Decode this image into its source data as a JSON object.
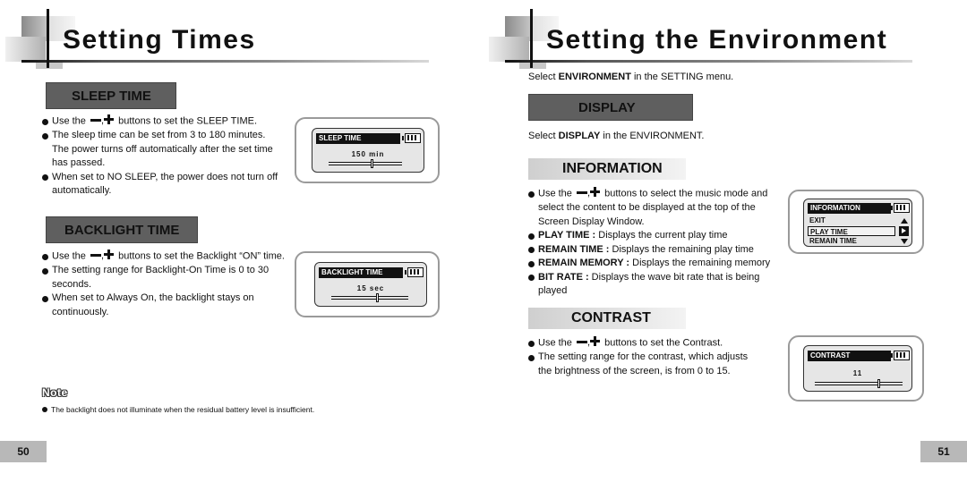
{
  "left_page": {
    "title": "Setting Times",
    "page_number": "50",
    "sleep_time": {
      "heading": "SLEEP TIME",
      "bullets": [
        {
          "pre": "Use the",
          "post": "buttons to set the SLEEP TIME."
        },
        {
          "text": "The sleep time can be set from 3 to 180 minutes. The power turns off automatically after the set time has passed."
        },
        {
          "text": "When set to NO SLEEP, the power does not turn off automatically."
        }
      ],
      "screen": {
        "label": "SLEEP TIME",
        "value": "150  min",
        "level": 0.6
      }
    },
    "backlight_time": {
      "heading": "BACKLIGHT TIME",
      "bullets": [
        {
          "pre": "Use the",
          "post": "buttons to set the Backlight “ON” time."
        },
        {
          "text": "The setting range for Backlight-On Time is 0 to 30 seconds."
        },
        {
          "text": "When set to Always On, the backlight stays on continuously."
        }
      ],
      "screen": {
        "label": "BACKLIGHT TIME",
        "value": "15  sec",
        "level": 0.6
      }
    },
    "note": {
      "title": "Note",
      "text": "The backlight does not illuminate when the residual battery level is insufficient."
    }
  },
  "right_page": {
    "title": "Setting the Environment",
    "page_number": "51",
    "intro": {
      "pre": "Select ",
      "bold": "ENVIRONMENT",
      "post": " in the SETTING menu."
    },
    "display": {
      "heading": "DISPLAY",
      "intro": {
        "pre": "Select ",
        "bold": "DISPLAY",
        "post": " in the ENVIRONMENT."
      }
    },
    "information": {
      "heading": "INFORMATION",
      "bullets": [
        {
          "pre": "Use the",
          "post": "buttons to select the music mode and select the content to be displayed at the top of the Screen Display Window."
        },
        {
          "bold": "PLAY TIME :",
          "text": " Displays the current play time"
        },
        {
          "bold": "REMAIN TIME :",
          "text": " Displays the remaining play time"
        },
        {
          "bold": "REMAIN MEMORY :",
          "text": " Displays the remaining memory"
        },
        {
          "bold": "BIT RATE :",
          "text": " Displays the wave bit rate that is being played"
        }
      ],
      "screen": {
        "label": "INFORMATION",
        "items": [
          "EXIT",
          "PLAY TIME",
          "REMAIN TIME"
        ],
        "selected": "PLAY TIME"
      }
    },
    "contrast": {
      "heading": "CONTRAST",
      "bullets": [
        {
          "pre": "Use the",
          "post": "buttons to set the Contrast."
        },
        {
          "text": "The setting range for the contrast, which adjusts the brightness of the screen, is from 0 to 15."
        }
      ],
      "screen": {
        "label": "CONTRAST",
        "value": "11",
        "level": 0.73
      }
    }
  }
}
